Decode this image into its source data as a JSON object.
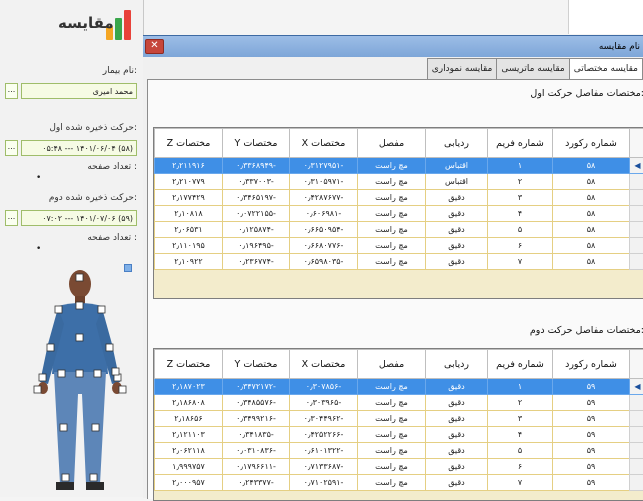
{
  "app": {
    "title": "مقایسه",
    "logo_icon": "bar-chart-logo",
    "logo_colors": [
      "#f5a623",
      "#3aa64b",
      "#e8423a"
    ]
  },
  "left_panel": {
    "patient_label": "نام بیمار:",
    "patient_name": "محمد امیری",
    "motion1_label": "حرکت ذخیره شده اول:",
    "motion1_value": "(۵۸) ۱۴۰۱/۰۶/۰۴ --- ۰۵:۴۸",
    "page_count_label": "تعداد صفحه :",
    "page_count_1": "•",
    "motion2_label": "حرکت ذخیره شده دوم:",
    "motion2_value": "(۵۹) ۱۴۰۱/۰۷/۰۶ --- ۰۷:۰۲",
    "page_count_2": "•",
    "dots_label": "..."
  },
  "window": {
    "title": "نام مقایسه",
    "close_label": "✕",
    "tabs": [
      {
        "label": "مقایسه مختصاتی",
        "active": true
      },
      {
        "label": "مقایسه ماتریسی",
        "active": false
      },
      {
        "label": "مقایسه نموداری",
        "active": false
      }
    ]
  },
  "section1": {
    "title": "مختصات مفاصل حرکت اول:",
    "headers": [
      "شماره رکورد",
      "شماره فریم",
      "ردیابی",
      "مفصل",
      "مختصات X",
      "مختصات Y",
      "مختصات Z"
    ],
    "rows": [
      [
        "۵۸",
        "۱",
        "اقتباس",
        "مچ راست",
        "-۰٫۳۱۲۷۹۵۱",
        "-۰٫۳۳۶۸۹۴۹",
        "۲٫۲۱۱۹۱۶"
      ],
      [
        "۵۸",
        "۲",
        "اقتباس",
        "مچ راست",
        "-۰٫۳۱۰۵۹۷۱",
        "-۰٫۳۳۷۰۰۳",
        "۲٫۲۱۰۷۷۹"
      ],
      [
        "۵۸",
        "۳",
        "دقیق",
        "مچ راست",
        "-۰٫۴۲۸۷۶۷۷",
        "-۰٫۳۴۶۵۱۹۷",
        "۲٫۱۷۷۴۲۹"
      ],
      [
        "۵۸",
        "۴",
        "دقیق",
        "مچ راست",
        "-۰٫۶۰۶۹۸۱",
        "-۰٫۰۷۲۲۱۵۵",
        "۲٫۱۰۸۱۸"
      ],
      [
        "۵۸",
        "۵",
        "دقیق",
        "مچ راست",
        "-۰٫۶۶۵۰۹۵۴",
        "-۰٫۱۲۵۸۷۴",
        "۲٫۰۶۵۳۱"
      ],
      [
        "۵۸",
        "۶",
        "دقیق",
        "مچ راست",
        "-۰٫۶۶۸۰۷۷۶",
        "-۰٫۱۹۶۴۹۵",
        "۲٫۱۱۰۱۹۵"
      ],
      [
        "۵۸",
        "۷",
        "دقیق",
        "مچ راست",
        "-۰٫۶۵۹۸۰۳۵",
        "-۰٫۲۳۶۷۷۴",
        "۲٫۱۰۹۲۲"
      ]
    ],
    "selected_row": 0
  },
  "section2": {
    "title": "مختصات مفاصل حرکت دوم:",
    "headers": [
      "شماره رکورد",
      "شماره فریم",
      "ردیابی",
      "مفصل",
      "مختصات X",
      "مختصات Y",
      "مختصات Z"
    ],
    "rows": [
      [
        "۵۹",
        "۱",
        "دقیق",
        "مچ راست",
        "-۰٫۳۰۷۸۵۶",
        "-۰٫۳۴۷۲۱۷۲",
        "۲٫۱۸۷۰۲۳"
      ],
      [
        "۵۹",
        "۲",
        "دقیق",
        "مچ راست",
        "-۰٫۳۰۳۹۶۵",
        "-۰٫۳۴۸۵۵۷۶",
        "۲٫۱۸۶۸۰۸"
      ],
      [
        "۵۹",
        "۳",
        "دقیق",
        "مچ راست",
        "-۰٫۳۰۴۴۹۶۲",
        "-۰٫۳۴۹۹۲۱۶",
        "۲٫۱۸۶۵۶"
      ],
      [
        "۵۹",
        "۴",
        "دقیق",
        "مچ راست",
        "-۰٫۴۲۵۲۲۶۶",
        "-۰٫۳۴۱۸۳۵",
        "۲٫۱۲۱۱۰۳"
      ],
      [
        "۵۹",
        "۵",
        "دقیق",
        "مچ راست",
        "-۰٫۶۱۰۱۳۲۲",
        "-۰٫۰۳۱۰۸۳۶",
        "۲٫۰۶۲۱۱۸"
      ],
      [
        "۵۹",
        "۶",
        "دقیق",
        "مچ راست",
        "-۰٫۷۱۳۳۶۸۷",
        "-۰٫۱۷۹۶۶۱۱",
        "۱٫۹۹۹۷۵۷"
      ],
      [
        "۵۹",
        "۷",
        "دقیق",
        "مچ راست",
        "-۰٫۷۱۰۲۵۹۱",
        "-۰٫۲۴۳۳۷۷",
        "۲٫۰۰۰۹۵۷"
      ]
    ],
    "selected_row": 0
  }
}
